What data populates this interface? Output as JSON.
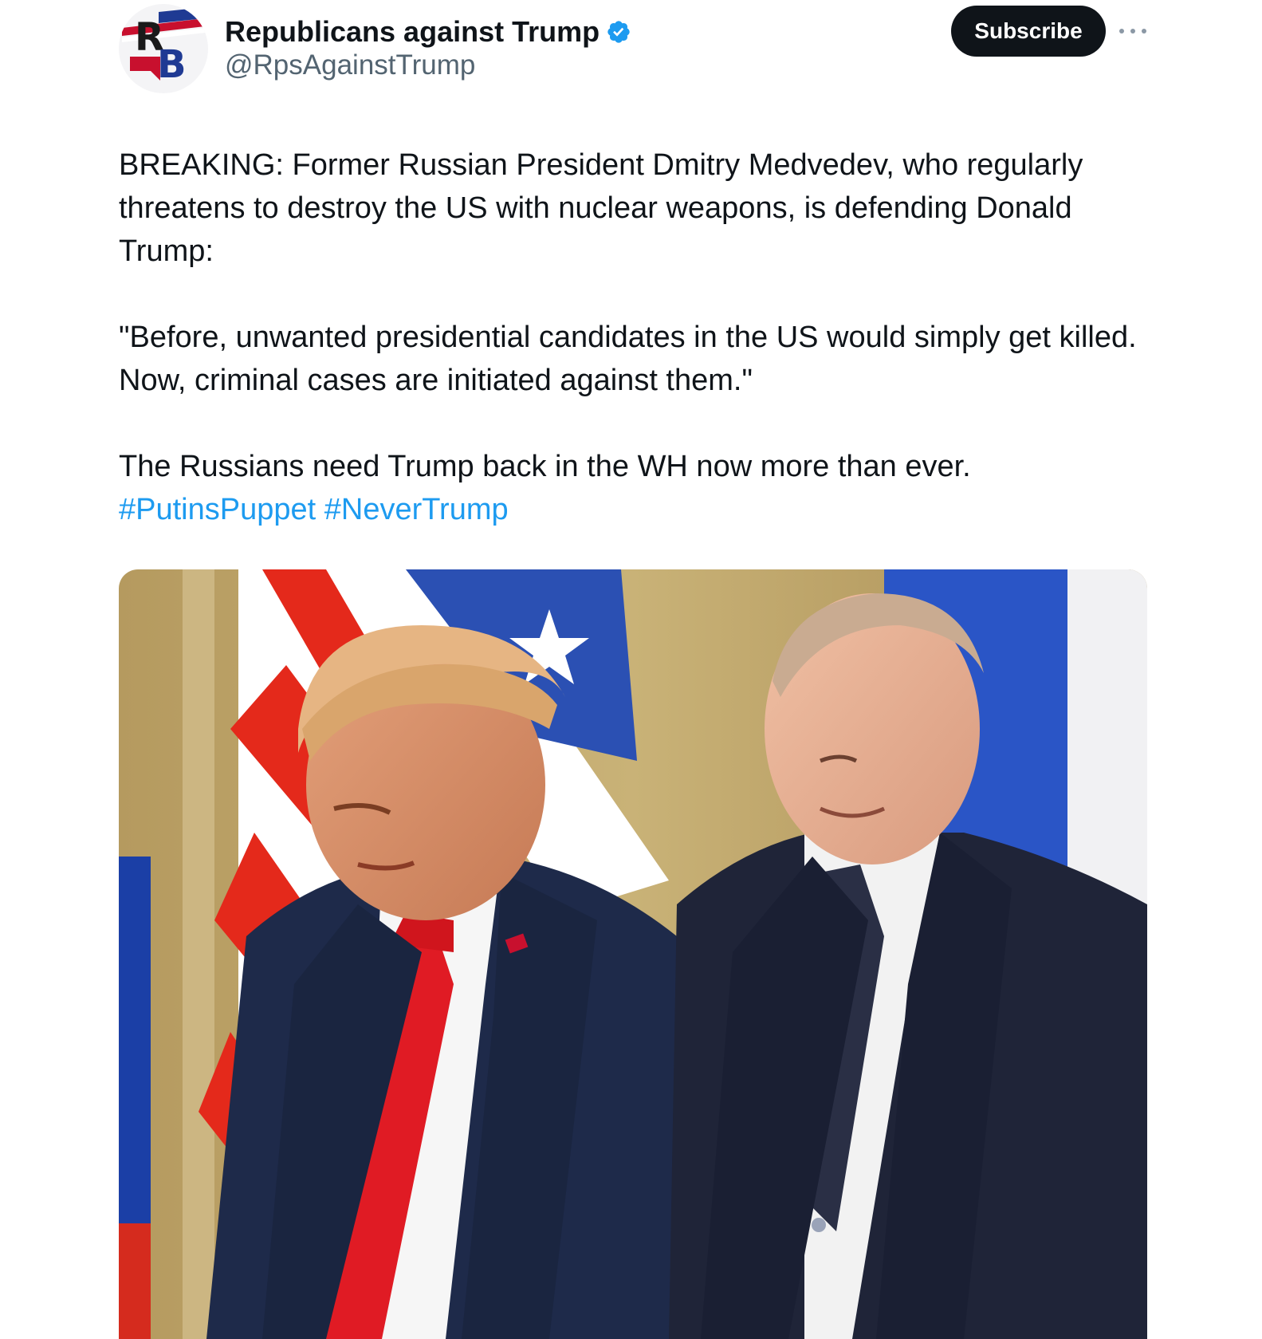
{
  "author": {
    "display_name": "Republicans against Trump",
    "handle": "@RpsAgainstTrump",
    "avatar_monogram": "RB",
    "avatar_icon": "republicans-against-trump-logo",
    "verified_icon": "verified-badge-icon",
    "verified_color": "#1d9bf0"
  },
  "actions": {
    "subscribe_label": "Subscribe",
    "more_icon": "more-options-icon"
  },
  "tweet": {
    "paragraphs": [
      "BREAKING: Former Russian President Dmitry Medvedev, who regularly threatens to destroy the US with nuclear weapons, is defending Donald Trump:",
      "\"Before, unwanted presidential candidates in the US would simply get killed. Now, criminal cases are initiated against them.\"",
      "The Russians need Trump back in the WH now more than ever."
    ],
    "hashtags": [
      "#PutinsPuppet",
      "#NeverTrump"
    ],
    "hashtag_color": "#1d9bf0"
  },
  "media": {
    "kind": "photo",
    "subject": "two-men-in-suits-photo"
  }
}
